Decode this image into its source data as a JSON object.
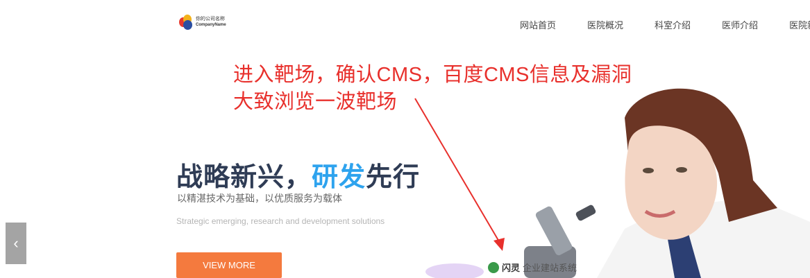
{
  "header": {
    "logo": {
      "name_cn": "你的公司名称",
      "name_en": "CompanyName"
    },
    "nav": [
      "网站首页",
      "医院概况",
      "科室介绍",
      "医师介绍",
      "医院新闻"
    ]
  },
  "annotation": {
    "line1": "进入靶场，确认CMS，百度CMS信息及漏洞",
    "line2": "大致浏览一波靶场",
    "color": "#e8302c"
  },
  "hero": {
    "headline_part1": "战略新兴，",
    "headline_highlight": "研发",
    "headline_part2": "先行",
    "subtitle_cn": "以精湛技术为基础，以优质服务为载体",
    "subtitle_en": "Strategic emerging, research and development  solutions",
    "button": "VIEW MORE",
    "prev_arrow": "‹"
  },
  "watermark": {
    "brand": "闪灵",
    "text": "企业建站系统",
    "icon": "leaf-logo-icon"
  },
  "colors": {
    "headline": "#2f3c55",
    "highlight": "#2ea3ee",
    "button": "#f47a3e",
    "arrow_bg": "#a4a4a4"
  }
}
